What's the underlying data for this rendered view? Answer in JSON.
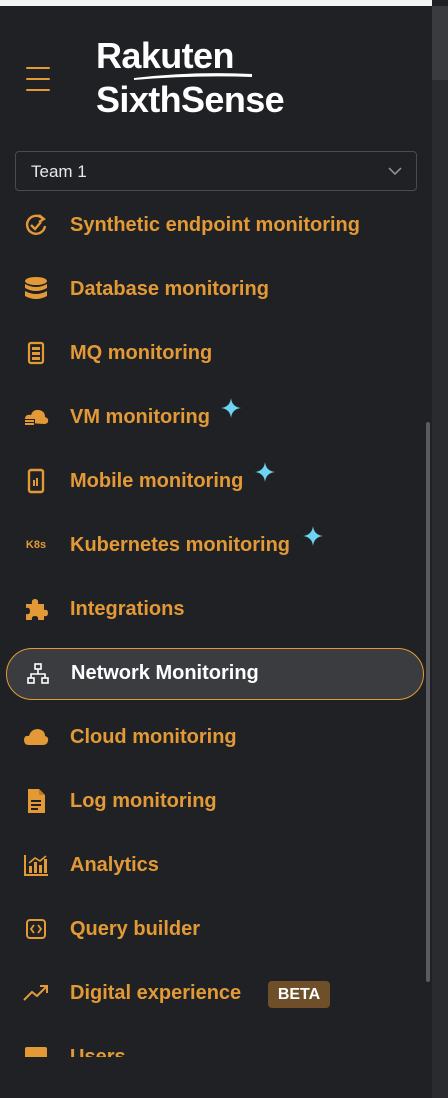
{
  "header": {
    "logo_line1": "Rakuten",
    "logo_line2": "SixthSense"
  },
  "team_select": {
    "value": "Team 1"
  },
  "nav": {
    "items": [
      {
        "label": "Synthetic endpoint monitoring",
        "icon": "sync-check-icon"
      },
      {
        "label": "Database monitoring",
        "icon": "database-icon"
      },
      {
        "label": "MQ monitoring",
        "icon": "message-queue-icon"
      },
      {
        "label": "VM monitoring",
        "icon": "vm-cloud-icon",
        "sparkle": true
      },
      {
        "label": "Mobile monitoring",
        "icon": "mobile-icon",
        "sparkle": true
      },
      {
        "label": "Kubernetes monitoring",
        "icon": "k8s-icon",
        "icon_text": "K8s",
        "sparkle": true
      },
      {
        "label": "Integrations",
        "icon": "puzzle-icon"
      },
      {
        "label": "Network Monitoring",
        "icon": "network-icon",
        "active": true
      },
      {
        "label": "Cloud monitoring",
        "icon": "cloud-icon"
      },
      {
        "label": "Log monitoring",
        "icon": "document-icon"
      },
      {
        "label": "Analytics",
        "icon": "analytics-icon"
      },
      {
        "label": "Query builder",
        "icon": "code-icon"
      },
      {
        "label": "Digital experience",
        "icon": "trend-icon",
        "badge": "BETA"
      },
      {
        "label": "Users",
        "icon": "users-icon"
      }
    ]
  },
  "colors": {
    "accent": "#e39a36",
    "background": "#202124",
    "active_bg": "#3b3c40",
    "sparkle": "#6fd3f2",
    "beta_bg": "#6e4f2a"
  }
}
